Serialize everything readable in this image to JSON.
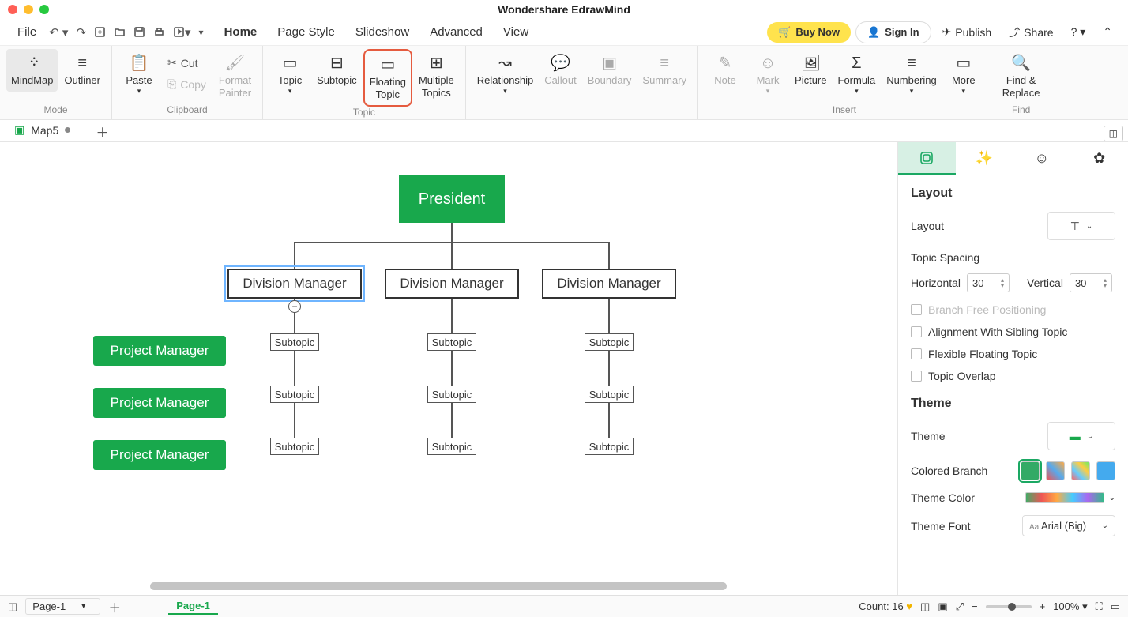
{
  "app": {
    "title": "Wondershare EdrawMind"
  },
  "menu": {
    "file": "File",
    "tabs": [
      "Home",
      "Page Style",
      "Slideshow",
      "Advanced",
      "View"
    ],
    "active": 0,
    "buy": "Buy Now",
    "signin": "Sign In",
    "publish": "Publish",
    "share": "Share"
  },
  "ribbon": {
    "mode": {
      "mindmap": "MindMap",
      "outliner": "Outliner",
      "group": "Mode"
    },
    "clipboard": {
      "paste": "Paste",
      "cut": "Cut",
      "copy": "Copy",
      "fmt": "Format\nPainter",
      "group": "Clipboard"
    },
    "topic": {
      "topic": "Topic",
      "subtopic": "Subtopic",
      "floating": "Floating\nTopic",
      "multiple": "Multiple\nTopics",
      "group": "Topic"
    },
    "rel": {
      "rel": "Relationship",
      "callout": "Callout",
      "boundary": "Boundary",
      "summary": "Summary"
    },
    "insert": {
      "note": "Note",
      "mark": "Mark",
      "picture": "Picture",
      "formula": "Formula",
      "numbering": "Numbering",
      "more": "More",
      "group": "Insert"
    },
    "find": {
      "find": "Find &\nReplace",
      "group": "Find"
    }
  },
  "doc": {
    "tab": "Map5"
  },
  "nodes": {
    "root": "President",
    "div1": "Division Manager",
    "div2": "Division Manager",
    "div3": "Division Manager",
    "sub": "Subtopic",
    "pm": "Project Manager"
  },
  "side": {
    "layout_h": "Layout",
    "layout_l": "Layout",
    "spacing": "Topic Spacing",
    "horizontal": "Horizontal",
    "h_val": "30",
    "vertical": "Vertical",
    "v_val": "30",
    "branch_free": "Branch Free Positioning",
    "align_sibling": "Alignment With Sibling Topic",
    "flex_float": "Flexible Floating Topic",
    "overlap": "Topic Overlap",
    "theme_h": "Theme",
    "theme_l": "Theme",
    "colored_branch": "Colored Branch",
    "theme_color": "Theme Color",
    "theme_font": "Theme Font",
    "font_val": "Arial (Big)"
  },
  "status": {
    "page_sel": "Page-1",
    "page_tab": "Page-1",
    "count": "Count: 16",
    "zoom": "100%"
  }
}
